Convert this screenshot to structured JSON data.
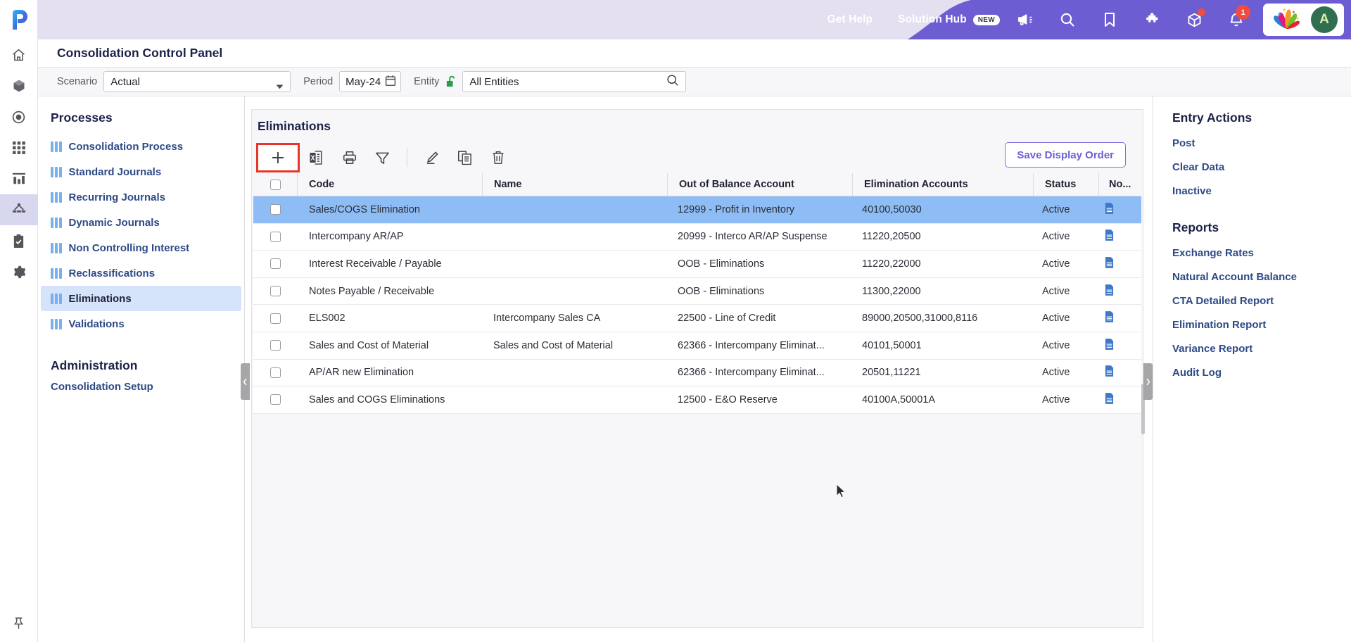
{
  "header": {
    "logo_icon": "planful-p-logo",
    "get_help": "Get Help",
    "solution_hub": "Solution Hub",
    "new_badge": "NEW",
    "notification_count": "1",
    "avatar_initial": "A",
    "accent_purple": "#6c5dd3",
    "header_bg": "#e4e0ef",
    "badge_red": "#ef4d42"
  },
  "rail": {
    "items": [
      {
        "name": "home-icon",
        "label": "Home"
      },
      {
        "name": "cube-icon",
        "label": "Modeling"
      },
      {
        "name": "target-icon",
        "label": "Planning"
      },
      {
        "name": "grid-icon",
        "label": "Apps"
      },
      {
        "name": "chart-icon",
        "label": "Reports"
      },
      {
        "name": "consolidation-icon",
        "label": "Consolidation"
      },
      {
        "name": "clipboard-check-icon",
        "label": "Tasks"
      },
      {
        "name": "gear-icon",
        "label": "Settings"
      }
    ],
    "pin_icon": "pin-icon",
    "active_index": 5
  },
  "page": {
    "title": "Consolidation Control Panel"
  },
  "filters": {
    "scenario_label": "Scenario",
    "scenario_value": "Actual",
    "period_label": "Period",
    "period_value": "May-24",
    "entity_label": "Entity",
    "entity_value": "All Entities",
    "entity_lock_icon": "unlocked-icon",
    "calendar_icon": "calendar-icon",
    "search_icon": "search-icon",
    "caret_icon": "chevron-down-icon"
  },
  "processes": {
    "heading": "Processes",
    "items": [
      {
        "label": "Consolidation Process",
        "active": false
      },
      {
        "label": "Standard Journals",
        "active": false
      },
      {
        "label": "Recurring Journals",
        "active": false
      },
      {
        "label": "Dynamic Journals",
        "active": false
      },
      {
        "label": "Non Controlling Interest",
        "active": false
      },
      {
        "label": "Reclassifications",
        "active": false
      },
      {
        "label": "Eliminations",
        "active": true
      },
      {
        "label": "Validations",
        "active": false
      }
    ],
    "admin_heading": "Administration",
    "admin_items": [
      {
        "label": "Consolidation Setup"
      }
    ]
  },
  "center": {
    "title": "Eliminations",
    "toolbar": [
      {
        "name": "add-button",
        "icon": "plus-icon",
        "highlighted": true
      },
      {
        "name": "export-excel-button",
        "icon": "excel-icon",
        "highlighted": false
      },
      {
        "name": "print-button",
        "icon": "printer-icon",
        "highlighted": false
      },
      {
        "name": "filter-button",
        "icon": "funnel-icon",
        "highlighted": false
      },
      {
        "name": "edit-button",
        "icon": "pencil-icon",
        "highlighted": false
      },
      {
        "name": "copy-button",
        "icon": "copy-icon",
        "highlighted": false
      },
      {
        "name": "delete-button",
        "icon": "trash-icon",
        "highlighted": false
      }
    ],
    "save_display_order": "Save Display Order",
    "columns": [
      "Code",
      "Name",
      "Out of Balance Account",
      "Elimination Accounts",
      "Status",
      "No..."
    ],
    "rows": [
      {
        "code": "Sales/COGS Elimination",
        "name": "",
        "out_of_balance_account": "12999 - Profit in Inventory",
        "elimination_accounts": "40100,50030",
        "status": "Active",
        "notes_icon": "document-icon",
        "selected": true
      },
      {
        "code": "Intercompany AR/AP",
        "name": "",
        "out_of_balance_account": "20999 - Interco AR/AP Suspense",
        "elimination_accounts": "11220,20500",
        "status": "Active",
        "notes_icon": "document-icon",
        "selected": false
      },
      {
        "code": "Interest Receivable / Payable",
        "name": "",
        "out_of_balance_account": "OOB - Eliminations",
        "elimination_accounts": "11220,22000",
        "status": "Active",
        "notes_icon": "document-icon",
        "selected": false
      },
      {
        "code": "Notes Payable / Receivable",
        "name": "",
        "out_of_balance_account": "OOB - Eliminations",
        "elimination_accounts": "11300,22000",
        "status": "Active",
        "notes_icon": "document-icon",
        "selected": false
      },
      {
        "code": "ELS002",
        "name": "Intercompany Sales CA",
        "out_of_balance_account": "22500 - Line of Credit",
        "elimination_accounts": "89000,20500,31000,8116",
        "status": "Active",
        "notes_icon": "document-icon",
        "selected": false
      },
      {
        "code": "Sales and Cost of Material",
        "name": "Sales and Cost of Material",
        "out_of_balance_account": "62366 - Intercompany Eliminat...",
        "elimination_accounts": "40101,50001",
        "status": "Active",
        "notes_icon": "document-icon",
        "selected": false
      },
      {
        "code": "AP/AR new Elimination",
        "name": "",
        "out_of_balance_account": "62366 - Intercompany Eliminat...",
        "elimination_accounts": "20501,11221",
        "status": "Active",
        "notes_icon": "document-icon",
        "selected": false
      },
      {
        "code": "Sales and COGS Eliminations",
        "name": "",
        "out_of_balance_account": "12500 - E&O Reserve",
        "elimination_accounts": "40100A,50001A",
        "status": "Active",
        "notes_icon": "document-icon",
        "selected": false
      }
    ]
  },
  "right_panel": {
    "entry_actions_heading": "Entry Actions",
    "entry_actions": [
      {
        "label": "Post"
      },
      {
        "label": "Clear Data"
      },
      {
        "label": "Inactive"
      }
    ],
    "reports_heading": "Reports",
    "reports": [
      {
        "label": "Exchange Rates"
      },
      {
        "label": "Natural Account Balance"
      },
      {
        "label": "CTA Detailed Report"
      },
      {
        "label": "Elimination Report"
      },
      {
        "label": "Variance Report"
      },
      {
        "label": "Audit Log"
      }
    ]
  },
  "misc": {
    "collapse_left_icon": "chevron-left-icon",
    "collapse_right_icon": "chevron-right-icon",
    "cursor_icon": "mouse-pointer-icon"
  }
}
